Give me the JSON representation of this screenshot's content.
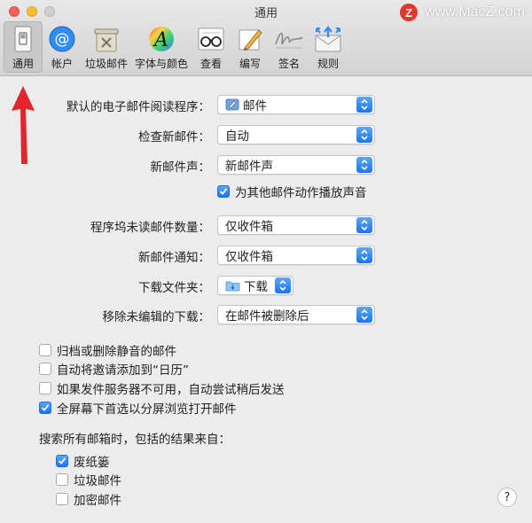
{
  "window": {
    "title": "通用"
  },
  "watermark": {
    "logo_letter": "Z",
    "text": "www.MacZ.com"
  },
  "toolbar": {
    "items": [
      {
        "label": "通用",
        "icon": "general-switch-icon",
        "selected": true
      },
      {
        "label": "帐户",
        "icon": "at-sign-icon"
      },
      {
        "label": "垃圾邮件",
        "icon": "trash-bin-icon"
      },
      {
        "label": "字体与颜色",
        "icon": "font-color-icon"
      },
      {
        "label": "查看",
        "icon": "glasses-icon"
      },
      {
        "label": "编写",
        "icon": "pencil-icon"
      },
      {
        "label": "签名",
        "icon": "signature-icon"
      },
      {
        "label": "规则",
        "icon": "rules-envelope-icon"
      }
    ]
  },
  "settings": {
    "default_reader": {
      "label": "默认的电子邮件阅读程序：",
      "value": "邮件"
    },
    "check_mail": {
      "label": "检查新邮件：",
      "value": "自动"
    },
    "new_mail_sound": {
      "label": "新邮件声：",
      "value": "新邮件声"
    },
    "play_sounds": {
      "label": "为其他邮件动作播放声音",
      "checked": true
    },
    "dock_unread": {
      "label": "程序坞未读邮件数量：",
      "value": "仅收件箱"
    },
    "new_mail_notify": {
      "label": "新邮件通知：",
      "value": "仅收件箱"
    },
    "downloads_folder": {
      "label": "下载文件夹：",
      "value": "下载"
    },
    "remove_downloads": {
      "label": "移除未编辑的下载：",
      "value": "在邮件被删除后"
    }
  },
  "options": [
    {
      "label": "归档或删除静音的邮件",
      "checked": false
    },
    {
      "label": "自动将邀请添加到“日历”",
      "checked": false
    },
    {
      "label": "如果发件服务器不可用，自动尝试稍后发送",
      "checked": false
    },
    {
      "label": "全屏幕下首选以分屏浏览打开邮件",
      "checked": true
    }
  ],
  "search": {
    "title": "搜索所有邮箱时，包括的结果来自：",
    "items": [
      {
        "label": "废纸篓",
        "checked": true
      },
      {
        "label": "垃圾邮件",
        "checked": false
      },
      {
        "label": "加密邮件",
        "checked": false
      }
    ]
  },
  "help": {
    "label": "?"
  },
  "colors": {
    "accent": "#1c74ee",
    "annotation_arrow": "#e3262d"
  }
}
